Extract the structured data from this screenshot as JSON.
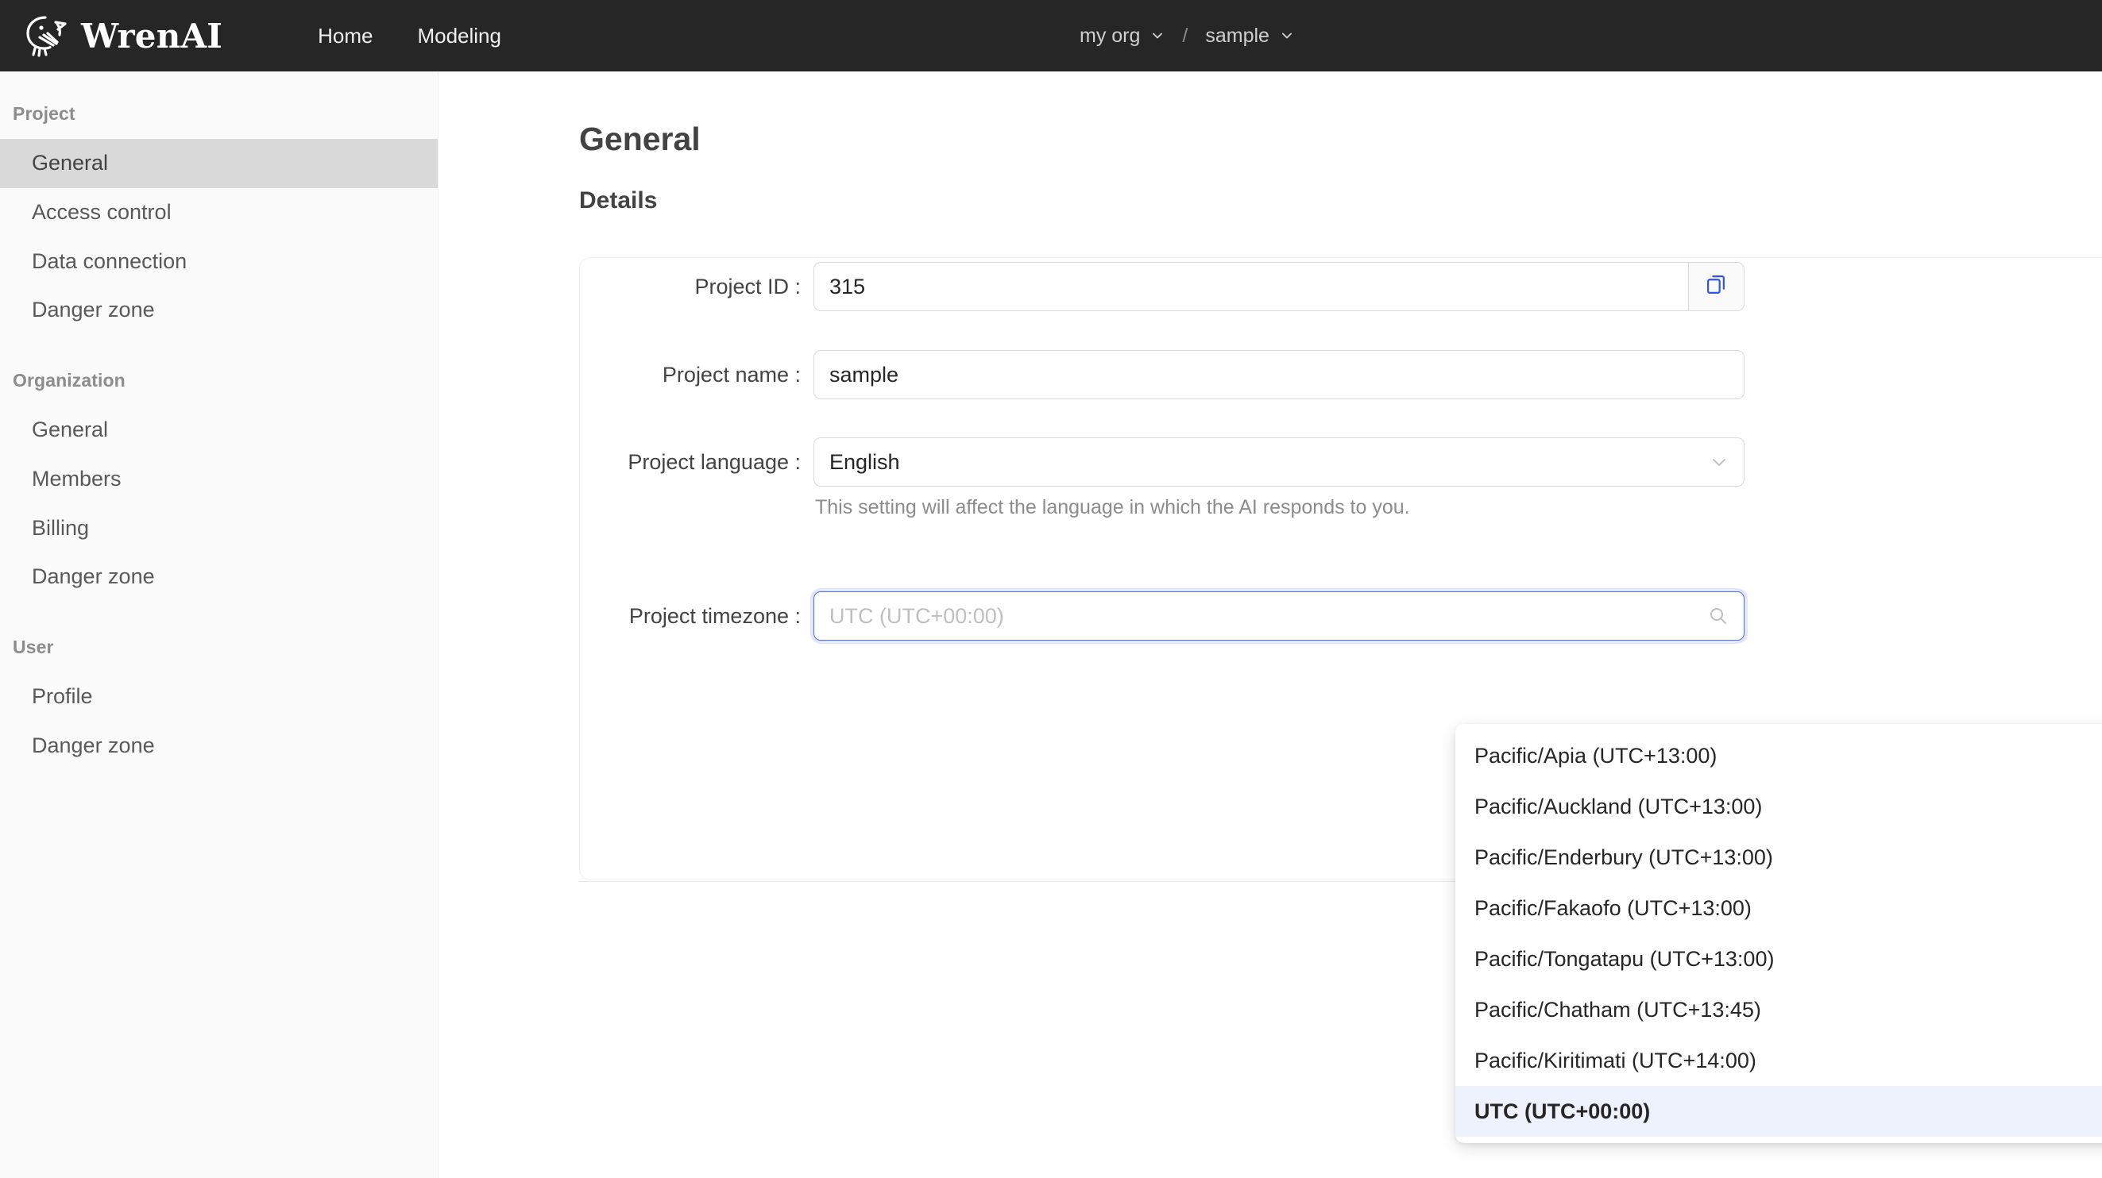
{
  "header": {
    "brand_name": "WrenAI",
    "logo_icon": "wren-bird-logo",
    "nav": [
      {
        "label": "Home"
      },
      {
        "label": "Modeling"
      }
    ],
    "org_selector": {
      "label": "my org",
      "icon": "chevron-down-icon"
    },
    "separator": "/",
    "project_selector": {
      "label": "sample",
      "icon": "chevron-down-icon"
    }
  },
  "sidebar": {
    "sections": [
      {
        "title": "Project",
        "items": [
          {
            "label": "General",
            "active": true
          },
          {
            "label": "Access control",
            "active": false
          },
          {
            "label": "Data connection",
            "active": false
          },
          {
            "label": "Danger zone",
            "active": false
          }
        ]
      },
      {
        "title": "Organization",
        "items": [
          {
            "label": "General",
            "active": false
          },
          {
            "label": "Members",
            "active": false
          },
          {
            "label": "Billing",
            "active": false
          },
          {
            "label": "Danger zone",
            "active": false
          }
        ]
      },
      {
        "title": "User",
        "items": [
          {
            "label": "Profile",
            "active": false
          },
          {
            "label": "Danger zone",
            "active": false
          }
        ]
      }
    ]
  },
  "main": {
    "page_title": "General",
    "section_title": "Details",
    "fields": {
      "project_id": {
        "label": "Project ID :",
        "value": "315",
        "copy_icon": "copy-icon",
        "copy_color": "#2f54eb"
      },
      "project_name": {
        "label": "Project name :",
        "value": "sample"
      },
      "project_language": {
        "label": "Project language :",
        "value": "English",
        "chevron_icon": "chevron-down-icon",
        "hint": "This setting will affect the language in which the AI responds to you."
      },
      "project_timezone": {
        "label": "Project timezone :",
        "value": "",
        "placeholder": "UTC (UTC+00:00)",
        "search_icon": "search-icon",
        "focus_color": "#4a6cf7"
      }
    },
    "timezone_dropdown": {
      "options": [
        {
          "label": "Pacific/Apia (UTC+13:00)",
          "selected": false
        },
        {
          "label": "Pacific/Auckland (UTC+13:00)",
          "selected": false
        },
        {
          "label": "Pacific/Enderbury (UTC+13:00)",
          "selected": false
        },
        {
          "label": "Pacific/Fakaofo (UTC+13:00)",
          "selected": false
        },
        {
          "label": "Pacific/Tongatapu (UTC+13:00)",
          "selected": false
        },
        {
          "label": "Pacific/Chatham (UTC+13:45)",
          "selected": false
        },
        {
          "label": "Pacific/Kiritimati (UTC+14:00)",
          "selected": false
        },
        {
          "label": "UTC (UTC+00:00)",
          "selected": true
        }
      ],
      "selected_bg": "#eef2fd"
    }
  }
}
